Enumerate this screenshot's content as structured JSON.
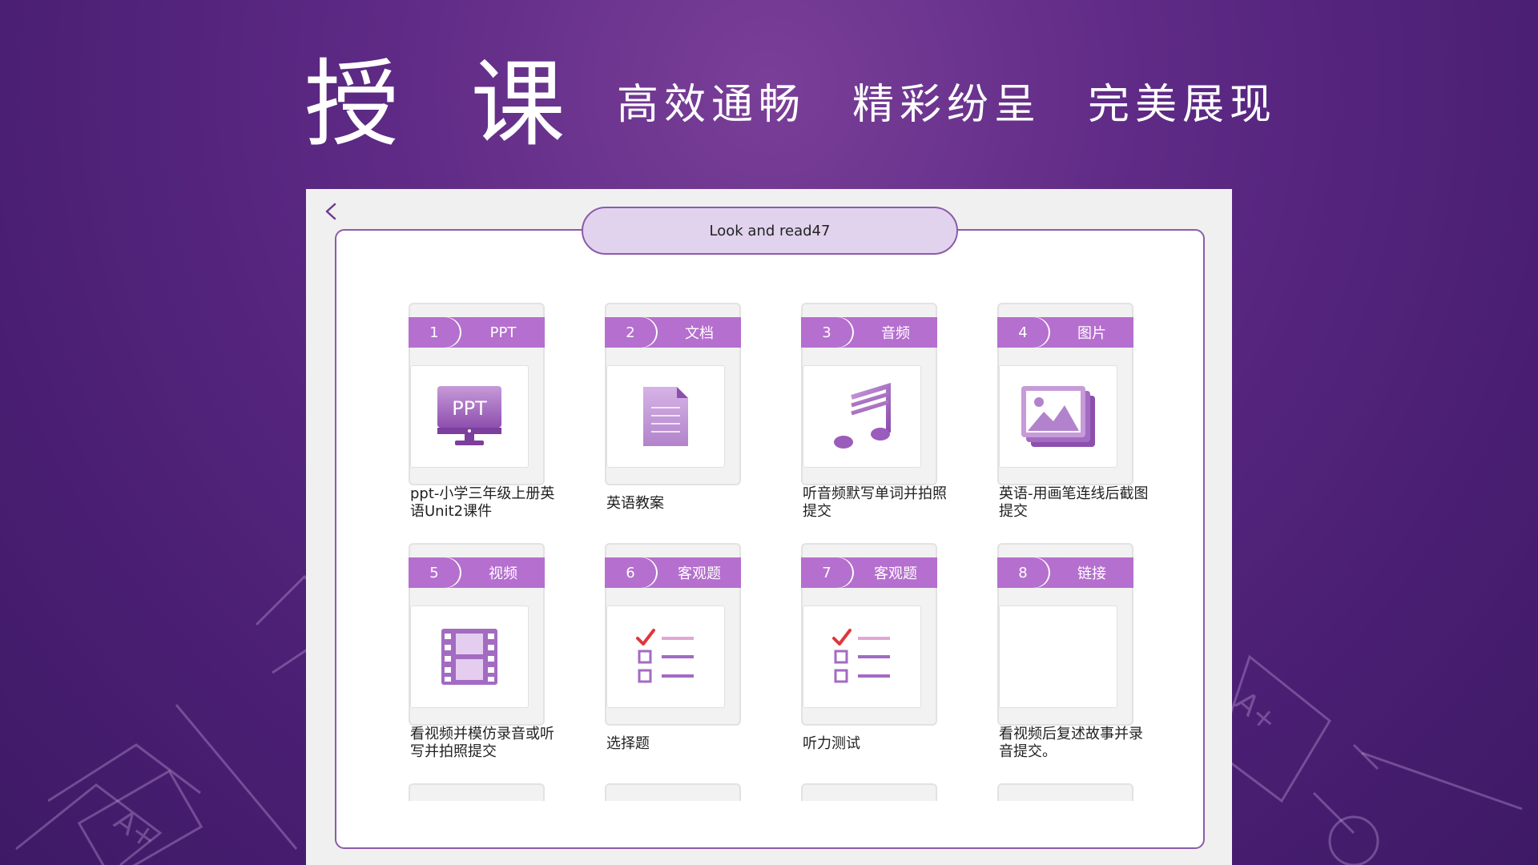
{
  "headline": {
    "title": "授 课",
    "slogans": [
      "高效通畅",
      "精彩纷呈",
      "完美展现"
    ]
  },
  "panel": {
    "title": "Look and read47",
    "cards": [
      {
        "number": "1",
        "type": "PPT",
        "icon": "ppt-monitor-icon",
        "thumb_text": "PPT",
        "caption": "ppt-小学三年级上册英语Unit2课件"
      },
      {
        "number": "2",
        "type": "文档",
        "icon": "document-icon",
        "caption": "英语教案"
      },
      {
        "number": "3",
        "type": "音频",
        "icon": "music-note-icon",
        "caption": "听音频默写单词并拍照提交"
      },
      {
        "number": "4",
        "type": "图片",
        "icon": "picture-icon",
        "caption": "英语-用画笔连线后截图提交"
      },
      {
        "number": "5",
        "type": "视频",
        "icon": "film-strip-icon",
        "caption": "看视频并模仿录音或听写并拍照提交"
      },
      {
        "number": "6",
        "type": "客观题",
        "icon": "checklist-icon",
        "caption": "选择题"
      },
      {
        "number": "7",
        "type": "客观题",
        "icon": "checklist-icon",
        "caption": "听力测试"
      },
      {
        "number": "8",
        "type": "链接",
        "icon": "blank-link-icon",
        "caption": "看视频后复述故事并录音提交。"
      }
    ]
  },
  "colors": {
    "accent": "#b56fce",
    "pill_bg": "#e1d3ee",
    "border": "#8c5ba8",
    "icon_purple": "#a36bc2",
    "check_red": "#e0363c"
  }
}
